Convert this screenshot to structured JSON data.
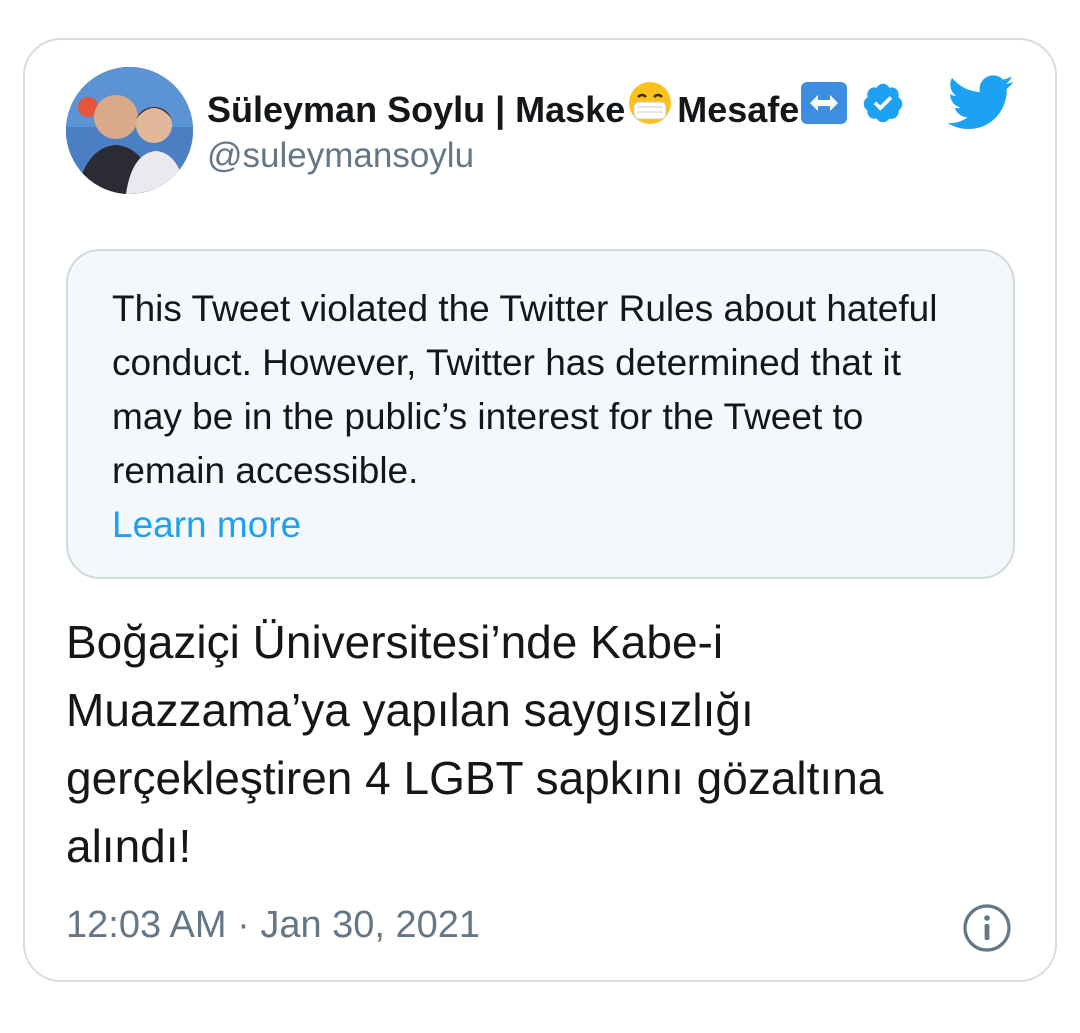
{
  "tweet": {
    "author": {
      "name_part1": "Süleyman Soylu | Maske",
      "name_part2": "Mesafe",
      "handle": "@suleymansoylu",
      "verified": true,
      "name_emoji_1": "face-with-medical-mask",
      "name_emoji_2": "left-right-arrow"
    },
    "notice": {
      "text": "This Tweet violated the Twitter Rules about hateful conduct. However, Twitter has determined that it may be in the public’s interest for the Tweet to remain accessible.",
      "link_label": "Learn more"
    },
    "body": "Boğaziçi Üniversitesi’nde Kabe-i Muazzama’ya yapılan saygısızlığı gerçekleştiren 4 LGBT sapkını gözaltına alındı!",
    "timestamp": "12:03 AM · Jan 30, 2021"
  },
  "colors": {
    "link": "#1da1f2",
    "secondary_text": "#657786",
    "notice_bg": "#f5f8fa",
    "border": "#d9dde1"
  },
  "icons": {
    "brand": "twitter-bird-icon",
    "verified": "verified-badge-icon",
    "info": "info-icon"
  }
}
